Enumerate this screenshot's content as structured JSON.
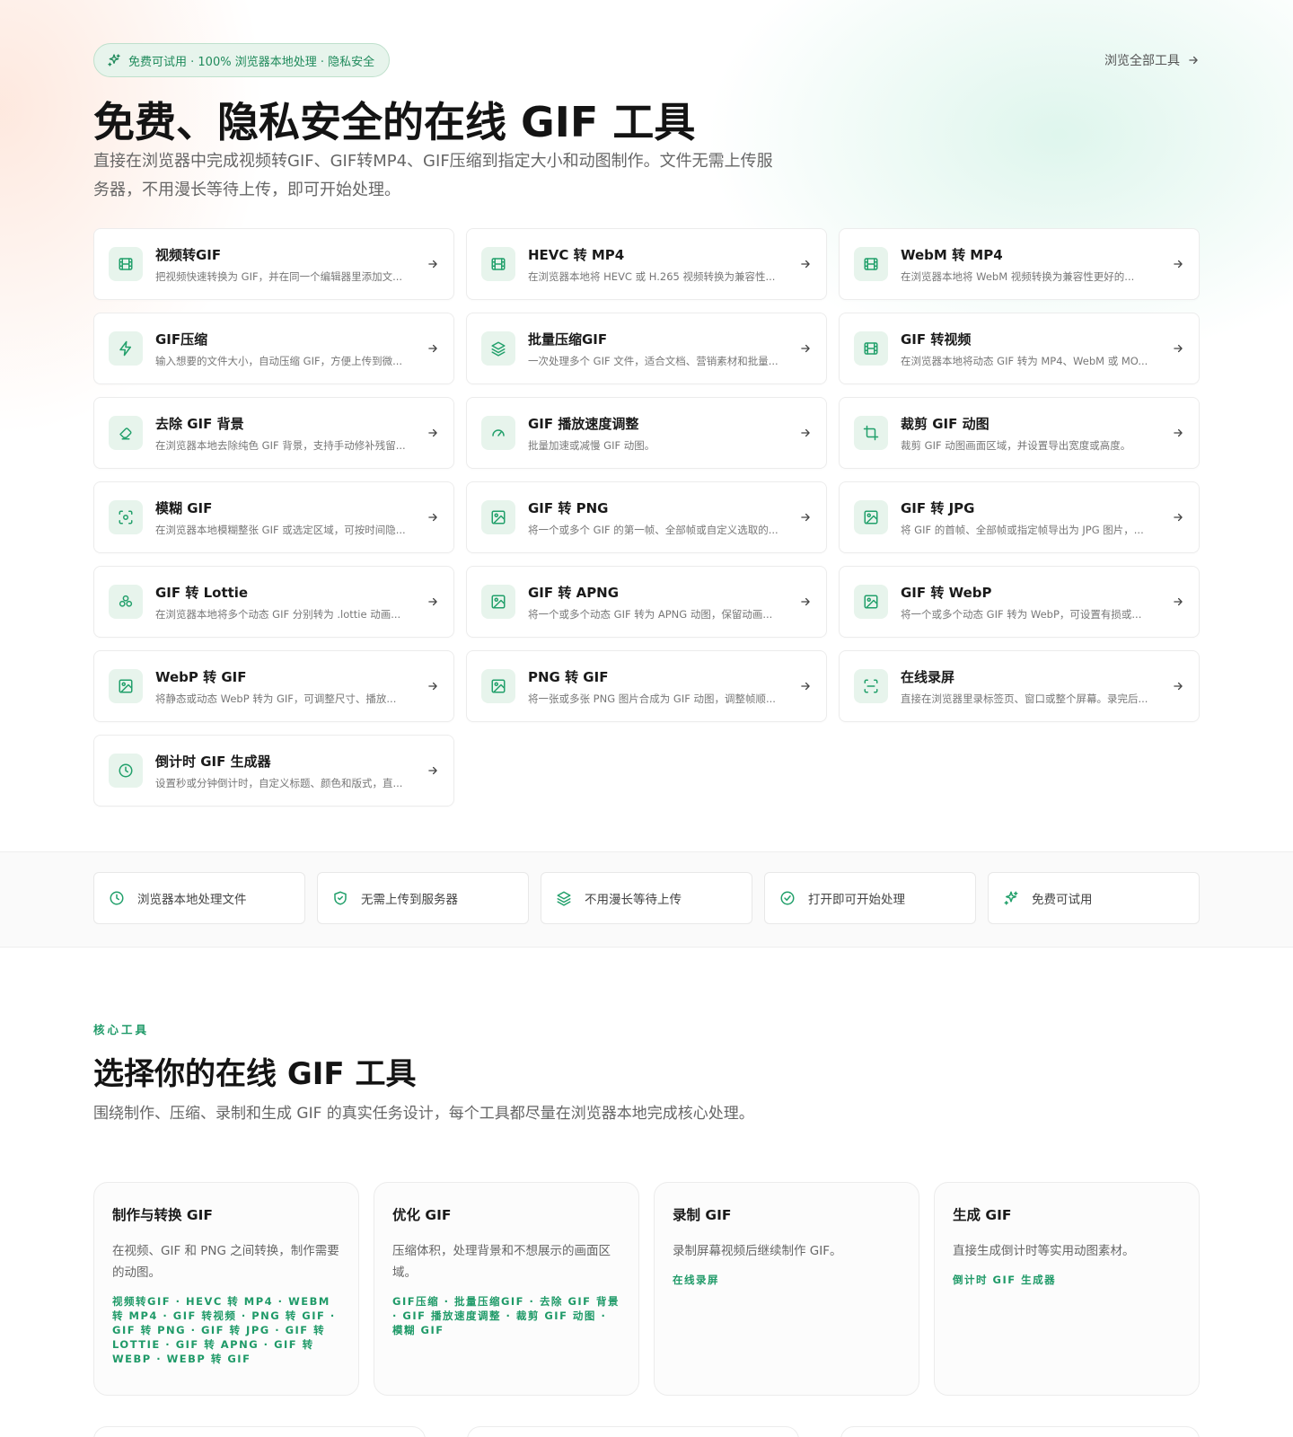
{
  "hero": {
    "badge": "免费可试用 · 100% 浏览器本地处理 · 隐私安全",
    "browse_all": "浏览全部工具",
    "title": "免费、隐私安全的在线 GIF 工具",
    "subtitle": "直接在浏览器中完成视频转GIF、GIF转MP4、GIF压缩到指定大小和动图制作。文件无需上传服务器，不用漫长等待上传，即可开始处理。"
  },
  "tools": [
    {
      "icon": "film-icon",
      "title": "视频转GIF",
      "desc": "把视频快速转换为 GIF，并在同一个编辑器里添加文..."
    },
    {
      "icon": "film-icon",
      "title": "HEVC 转 MP4",
      "desc": "在浏览器本地将 HEVC 或 H.265 视频转换为兼容性..."
    },
    {
      "icon": "film-icon",
      "title": "WebM 转 MP4",
      "desc": "在浏览器本地将 WebM 视频转换为兼容性更好的..."
    },
    {
      "icon": "bolt-icon",
      "title": "GIF压缩",
      "desc": "输入想要的文件大小，自动压缩 GIF，方便上传到微..."
    },
    {
      "icon": "layers-icon",
      "title": "批量压缩GIF",
      "desc": "一次处理多个 GIF 文件，适合文档、营销素材和批量..."
    },
    {
      "icon": "film-icon",
      "title": "GIF 转视频",
      "desc": "在浏览器本地将动态 GIF 转为 MP4、WebM 或 MO..."
    },
    {
      "icon": "eraser-icon",
      "title": "去除 GIF 背景",
      "desc": "在浏览器本地去除纯色 GIF 背景，支持手动修补残留..."
    },
    {
      "icon": "gauge-icon",
      "title": "GIF 播放速度调整",
      "desc": "批量加速或减慢 GIF 动图。"
    },
    {
      "icon": "crop-icon",
      "title": "裁剪 GIF 动图",
      "desc": "裁剪 GIF 动图画面区域，并设置导出宽度或高度。"
    },
    {
      "icon": "focus-icon",
      "title": "模糊 GIF",
      "desc": "在浏览器本地模糊整张 GIF 或选定区域，可按时间隐..."
    },
    {
      "icon": "image-icon",
      "title": "GIF 转 PNG",
      "desc": "将一个或多个 GIF 的第一帧、全部帧或自定义选取的..."
    },
    {
      "icon": "image-icon",
      "title": "GIF 转 JPG",
      "desc": "将 GIF 的首帧、全部帧或指定帧导出为 JPG 图片，..."
    },
    {
      "icon": "shapes-icon",
      "title": "GIF 转 Lottie",
      "desc": "在浏览器本地将多个动态 GIF 分别转为 .lottie 动画..."
    },
    {
      "icon": "image-icon",
      "title": "GIF 转 APNG",
      "desc": "将一个或多个动态 GIF 转为 APNG 动图，保留动画..."
    },
    {
      "icon": "image-icon",
      "title": "GIF 转 WebP",
      "desc": "将一个或多个动态 GIF 转为 WebP，可设置有损或..."
    },
    {
      "icon": "image-icon",
      "title": "WebP 转 GIF",
      "desc": "将静态或动态 WebP 转为 GIF，可调整尺寸、播放..."
    },
    {
      "icon": "image-icon",
      "title": "PNG 转 GIF",
      "desc": "将一张或多张 PNG 图片合成为 GIF 动图，调整帧顺..."
    },
    {
      "icon": "screen-record-icon",
      "title": "在线录屏",
      "desc": "直接在浏览器里录标签页、窗口或整个屏幕。录完后..."
    },
    {
      "icon": "clock-icon",
      "title": "倒计时 GIF 生成器",
      "desc": "设置秒或分钟倒计时，自定义标题、颜色和版式，直..."
    }
  ],
  "features": [
    {
      "icon": "clock-icon",
      "label": "浏览器本地处理文件"
    },
    {
      "icon": "shield-check-icon",
      "label": "无需上传到服务器"
    },
    {
      "icon": "layers-icon",
      "label": "不用漫长等待上传"
    },
    {
      "icon": "check-circle-icon",
      "label": "打开即可开始处理"
    },
    {
      "icon": "sparkle-icon",
      "label": "免费可试用"
    }
  ],
  "section": {
    "eyebrow": "核心工具",
    "title": "选择你的在线 GIF 工具",
    "subtitle": "围绕制作、压缩、录制和生成 GIF 的真实任务设计，每个工具都尽量在浏览器本地完成核心处理。"
  },
  "categories": [
    {
      "title": "制作与转换 GIF",
      "desc": "在视频、GIF 和 PNG 之间转换，制作需要的动图。",
      "links": [
        "视频转GIF",
        "HEVC 转 MP4",
        "WEBM 转 MP4",
        "GIF 转视频",
        "PNG 转 GIF",
        "GIF 转 PNG",
        "GIF 转 JPG",
        "GIF 转 LOTTIE",
        "GIF 转 APNG",
        "GIF 转 WEBP",
        "WEBP 转 GIF"
      ]
    },
    {
      "title": "优化 GIF",
      "desc": "压缩体积，处理背景和不想展示的画面区域。",
      "links": [
        "GIF压缩",
        "批量压缩GIF",
        "去除 GIF 背景",
        "GIF 播放速度调整",
        "裁剪 GIF 动图",
        "模糊 GIF"
      ]
    },
    {
      "title": "录制 GIF",
      "desc": "录制屏幕视频后继续制作 GIF。",
      "links": [
        "在线录屏"
      ]
    },
    {
      "title": "生成 GIF",
      "desc": "直接生成倒计时等实用动图素材。",
      "links": [
        "倒计时 GIF 生成器"
      ]
    }
  ],
  "colors": {
    "accent": "#22a06b",
    "accent_text": "#1f9a68",
    "icon_bg": "#e7f4ec"
  }
}
